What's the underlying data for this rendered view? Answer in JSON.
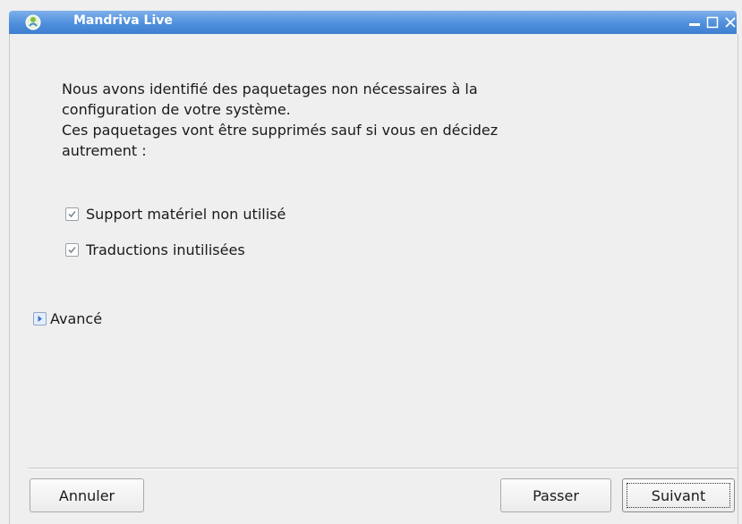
{
  "window": {
    "title": "Mandriva Live",
    "icon": "mandriva-star-icon",
    "controls": [
      "minimize-icon",
      "maximize-icon",
      "close-icon"
    ]
  },
  "message": "Nous avons identifié des paquetages non nécessaires à la\nconfiguration de votre système.\nCes paquetages vont être supprimés sauf si vous en décidez\nautrement :",
  "options": [
    {
      "label": "Support matériel non utilisé",
      "checked": true
    },
    {
      "label": "Traductions inutilisées",
      "checked": true
    }
  ],
  "advanced": {
    "label": "Avancé",
    "expanded": false
  },
  "buttons": {
    "cancel": "Annuler",
    "skip": "Passer",
    "next": "Suivant"
  },
  "colors": {
    "titlebar": "#4f8fdc",
    "background": "#efefef",
    "checkmark": "#7a8a9a"
  }
}
